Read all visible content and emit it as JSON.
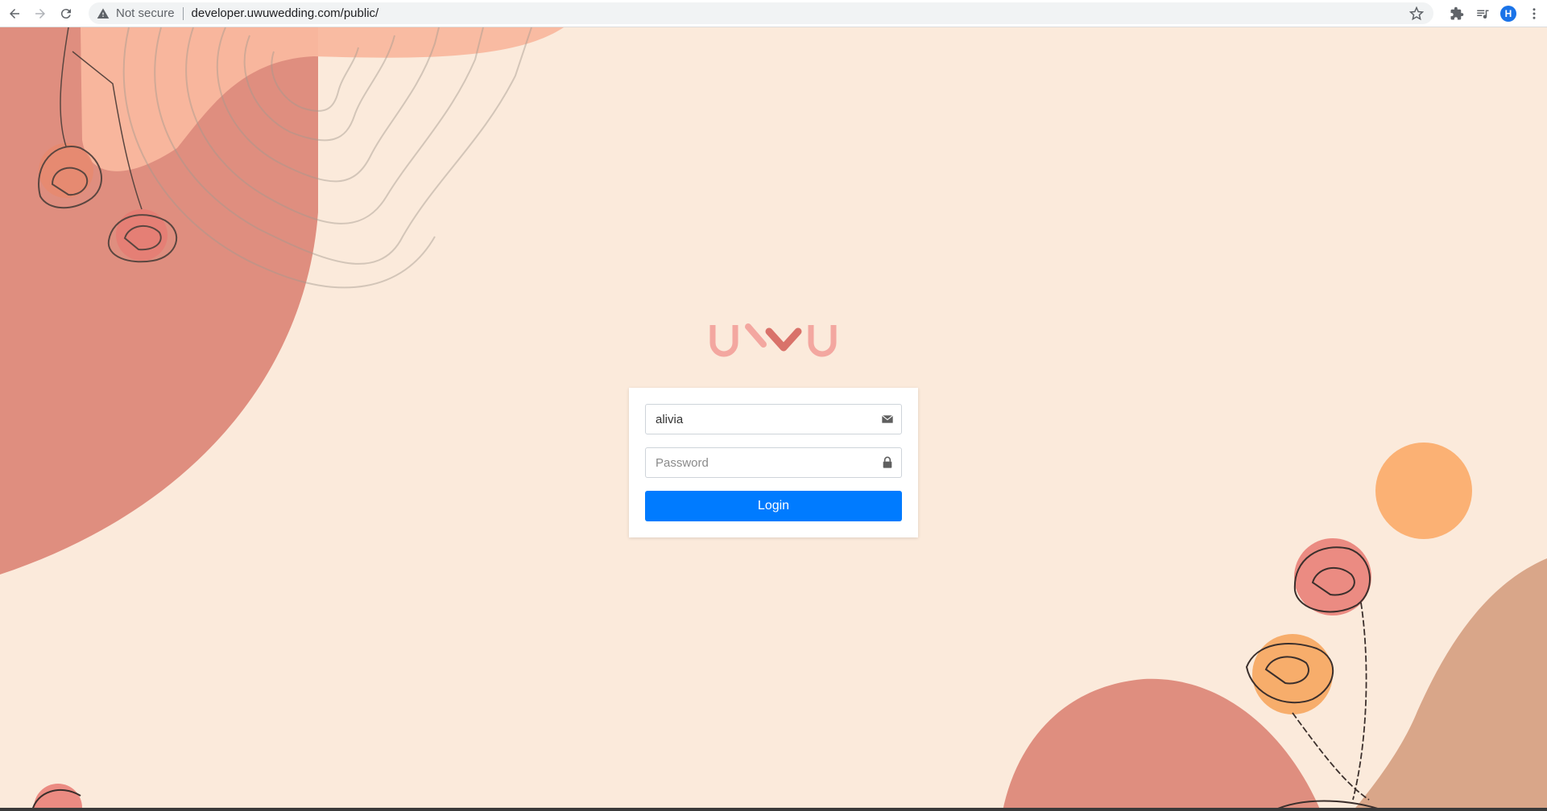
{
  "browser": {
    "security_label": "Not secure",
    "url": "developer.uwuwedding.com/public/",
    "profile_initial": "H"
  },
  "login": {
    "username_value": "alivia",
    "password_placeholder": "Password",
    "submit_label": "Login"
  },
  "colors": {
    "background": "#fbeadb",
    "primary_button": "#007bff",
    "logo_pink": "#f3a7a0",
    "logo_heart": "#d9726a"
  },
  "icons": {
    "back": "arrow-left-icon",
    "forward": "arrow-right-icon",
    "reload": "reload-icon",
    "warning": "warning-icon",
    "bookmark": "star-icon",
    "extensions": "puzzle-icon",
    "reading_list": "reading-list-icon",
    "menu": "kebab-menu-icon",
    "email": "envelope-icon",
    "password": "lock-icon"
  }
}
